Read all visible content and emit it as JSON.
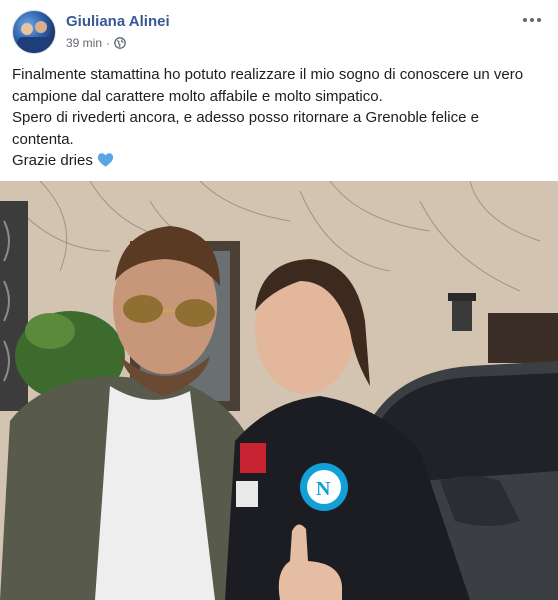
{
  "post": {
    "author": "Giuliana Alinei",
    "timestamp": "39 min",
    "separator": "·",
    "privacy_icon": "globe-icon",
    "more_icon": "more-options-icon",
    "paragraphs": [
      "Finalmente stamattina ho potuto realizzare il mio sogno di conoscere un vero campione dal carattere molto affabile e molto simpatico.",
      "Spero di rivederti ancora, e adesso posso ritornare a Grenoble felice e contenta.",
      "Grazie dries"
    ],
    "emoji_icon": "blue-heart-icon"
  },
  "colors": {
    "author_link": "#385898",
    "meta_text": "#606770",
    "body_text": "#1c1e21",
    "heart": "#5ba4e6",
    "napoli_blue": "#12a0d7"
  }
}
